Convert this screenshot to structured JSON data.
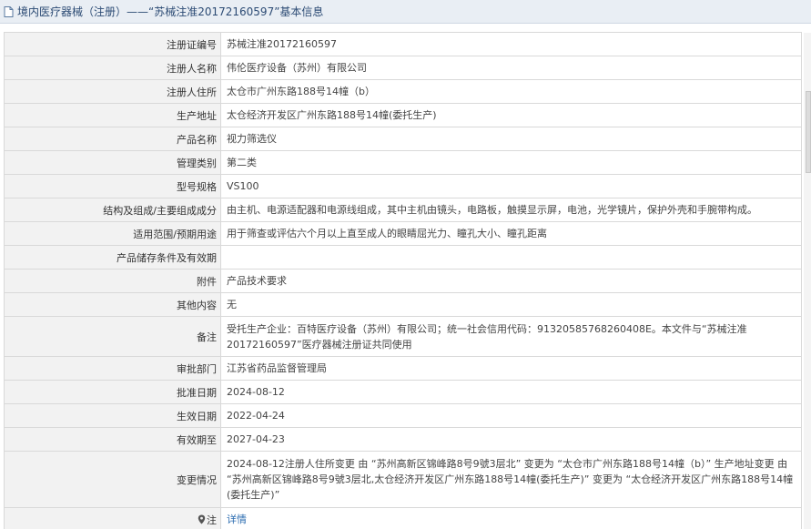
{
  "header": {
    "title": "境内医疗器械（注册）——“苏械注准20172160597”基本信息",
    "icon": "document-icon"
  },
  "rows": [
    {
      "label": "注册证编号",
      "value": "苏械注准20172160597"
    },
    {
      "label": "注册人名称",
      "value": "伟伦医疗设备（苏州）有限公司"
    },
    {
      "label": "注册人住所",
      "value": "太仓市广州东路188号14幢（b）"
    },
    {
      "label": "生产地址",
      "value": "太仓经济开发区广州东路188号14幢(委托生产)"
    },
    {
      "label": "产品名称",
      "value": "视力筛选仪"
    },
    {
      "label": "管理类别",
      "value": "第二类"
    },
    {
      "label": "型号规格",
      "value": "VS100"
    },
    {
      "label": "结构及组成/主要组成成分",
      "value": "由主机、电源适配器和电源线组成，其中主机由镜头，电路板，触摸显示屏，电池，光学镜片，保护外壳和手腕带构成。"
    },
    {
      "label": "适用范围/预期用途",
      "value": "用于筛查或评估六个月以上直至成人的眼睛屈光力、瞳孔大小、瞳孔距离"
    },
    {
      "label": "产品储存条件及有效期",
      "value": ""
    },
    {
      "label": "附件",
      "value": "产品技术要求"
    },
    {
      "label": "其他内容",
      "value": "无"
    },
    {
      "label": "备注",
      "value": "受托生产企业：百特医疗设备（苏州）有限公司；统一社会信用代码：91320585768260408E。本文件与“苏械注准20172160597”医疗器械注册证共同使用"
    },
    {
      "label": "审批部门",
      "value": "江苏省药品监督管理局"
    },
    {
      "label": "批准日期",
      "value": "2024-08-12"
    },
    {
      "label": "生效日期",
      "value": "2022-04-24"
    },
    {
      "label": "有效期至",
      "value": "2027-04-23"
    },
    {
      "label": "变更情况",
      "value": "2024-08-12注册人住所变更 由 “苏州高新区锦峰路8号9號3层北” 变更为 “太仓市广州东路188号14幢（b）” 生产地址变更 由 “苏州高新区锦峰路8号9號3层北,太仓经济开发区广州东路188号14幢(委托生产)” 变更为 “太仓经济开发区广州东路188号14幢(委托生产)”"
    }
  ],
  "note": {
    "icon": "location-pin-icon",
    "label": "注",
    "link_text": "详情"
  }
}
